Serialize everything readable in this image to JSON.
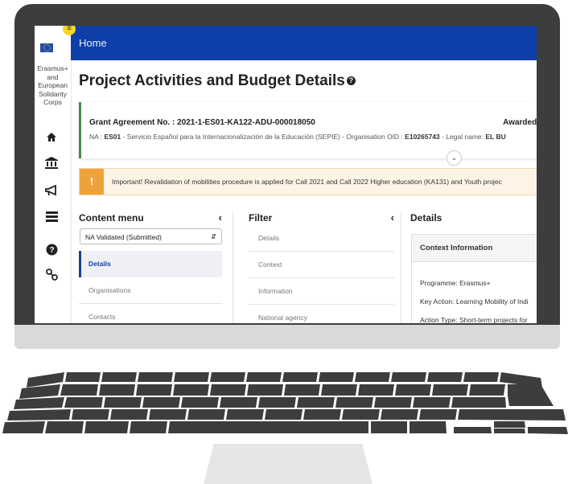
{
  "sidebar": {
    "menu_badge": "≡",
    "org_label": "Erasmus+ and European Solidarity Corps",
    "icons": [
      "home-icon",
      "bank-icon",
      "megaphone-icon",
      "list-icon",
      "help-icon",
      "link-icon"
    ]
  },
  "topbar": {
    "home": "Home"
  },
  "page": {
    "title": "Project Activities and Budget Details"
  },
  "grant": {
    "number": "Grant Agreement No. : 2021-1-ES01-KA122-ADU-000018050",
    "status": "Awarded,",
    "na_prefix": "NA : ",
    "na_code": "ES01",
    "na_text": " - Servicio Español para la Internacionalización de la Educación (SEPIE) - Organisation OID : ",
    "oid": "E10265743",
    "legal_prefix": " - Legal name: ",
    "legal": "EL BU"
  },
  "warning": {
    "text": "Important! Revalidation of mobilities procedure is applied for Call 2021 and Call 2022 Higher education (KA131) and Youth projec"
  },
  "content_menu": {
    "title": "Content menu",
    "select_value": "NA Validated (Submitted)",
    "items": [
      "Details",
      "Organisations",
      "Contacts"
    ]
  },
  "filter": {
    "title": "Filter",
    "items": [
      "Details",
      "Context",
      "Information",
      "National agency"
    ]
  },
  "details": {
    "title": "Details",
    "card_title": "Context Information",
    "lines": [
      "Programme: Erasmus+",
      "Key Action: Learning Mobility of Indi",
      "Action Type: Short-term projects for"
    ]
  },
  "colors": {
    "topbar": "#0e3fa8",
    "accent": "#1a3e9a",
    "warning": "#f0a23a",
    "badge": "#f5d623"
  }
}
